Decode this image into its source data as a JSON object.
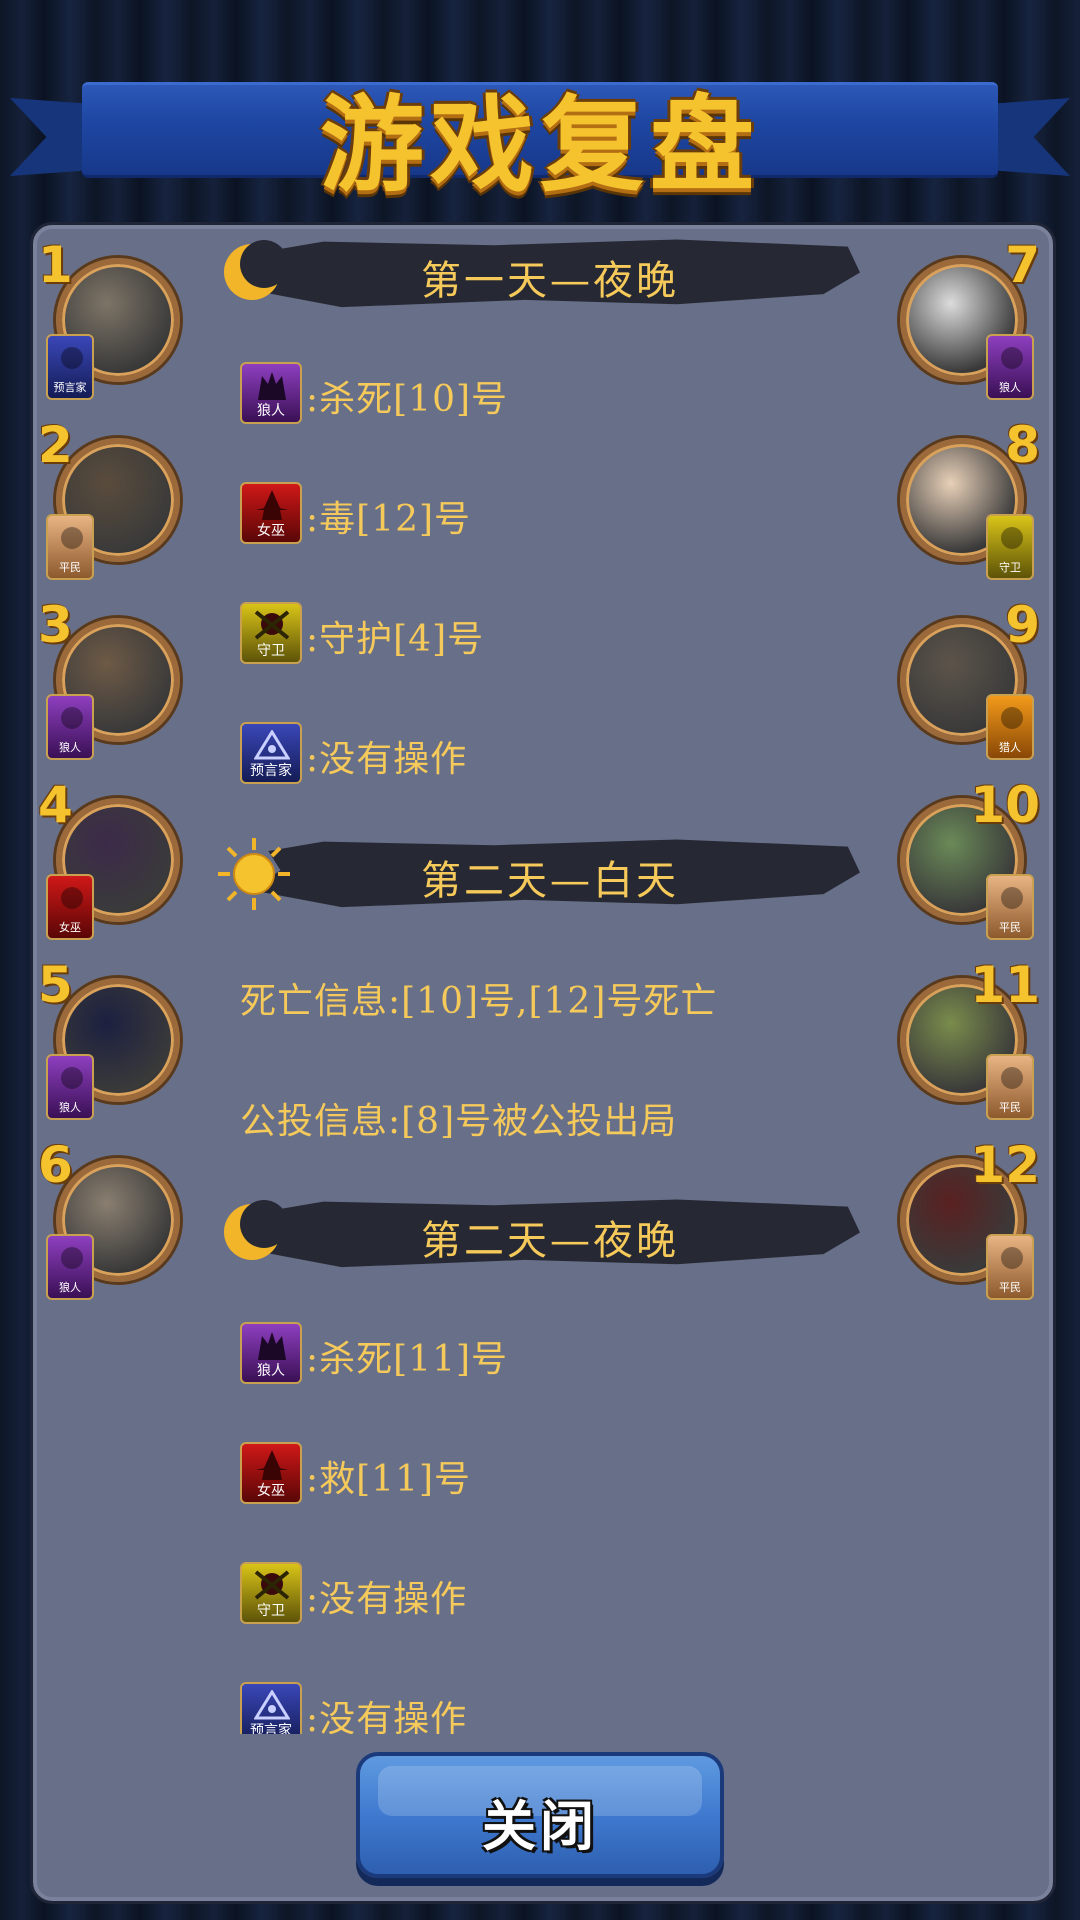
{
  "header": {
    "title": "游戏复盘"
  },
  "left_players": [
    {
      "num": "1",
      "role": "预言家",
      "role_key": "seer"
    },
    {
      "num": "2",
      "role": "平民",
      "role_key": "villager"
    },
    {
      "num": "3",
      "role": "狼人",
      "role_key": "wolf"
    },
    {
      "num": "4",
      "role": "女巫",
      "role_key": "witch"
    },
    {
      "num": "5",
      "role": "狼人",
      "role_key": "wolf"
    },
    {
      "num": "6",
      "role": "狼人",
      "role_key": "wolf"
    }
  ],
  "right_players": [
    {
      "num": "7",
      "role": "狼人",
      "role_key": "wolf"
    },
    {
      "num": "8",
      "role": "守卫",
      "role_key": "guard"
    },
    {
      "num": "9",
      "role": "猎人",
      "role_key": "hunter"
    },
    {
      "num": "10",
      "role": "平民",
      "role_key": "villager"
    },
    {
      "num": "11",
      "role": "平民",
      "role_key": "villager"
    },
    {
      "num": "12",
      "role": "平民",
      "role_key": "villager"
    }
  ],
  "log": {
    "night1": {
      "title": "第一天—夜晚",
      "entries": [
        {
          "role": "狼人",
          "text": ":杀死[10]号"
        },
        {
          "role": "女巫",
          "text": ":毒[12]号"
        },
        {
          "role": "守卫",
          "text": ":守护[4]号"
        },
        {
          "role": "预言家",
          "text": ":没有操作"
        }
      ]
    },
    "day2": {
      "title": "第二天—白天",
      "death_info": "死亡信息:[10]号,[12]号死亡",
      "vote_info": "公投信息:[8]号被公投出局"
    },
    "night2": {
      "title": "第二天—夜晚",
      "entries": [
        {
          "role": "狼人",
          "text": ":杀死[11]号"
        },
        {
          "role": "女巫",
          "text": ":救[11]号"
        },
        {
          "role": "守卫",
          "text": ":没有操作"
        },
        {
          "role": "预言家",
          "text": ":没有操作"
        }
      ]
    }
  },
  "footer": {
    "close_label": "关闭"
  },
  "colors": {
    "accent_gold": "#f5c95a",
    "panel": "#686f89",
    "button": "#3f7ad0"
  }
}
